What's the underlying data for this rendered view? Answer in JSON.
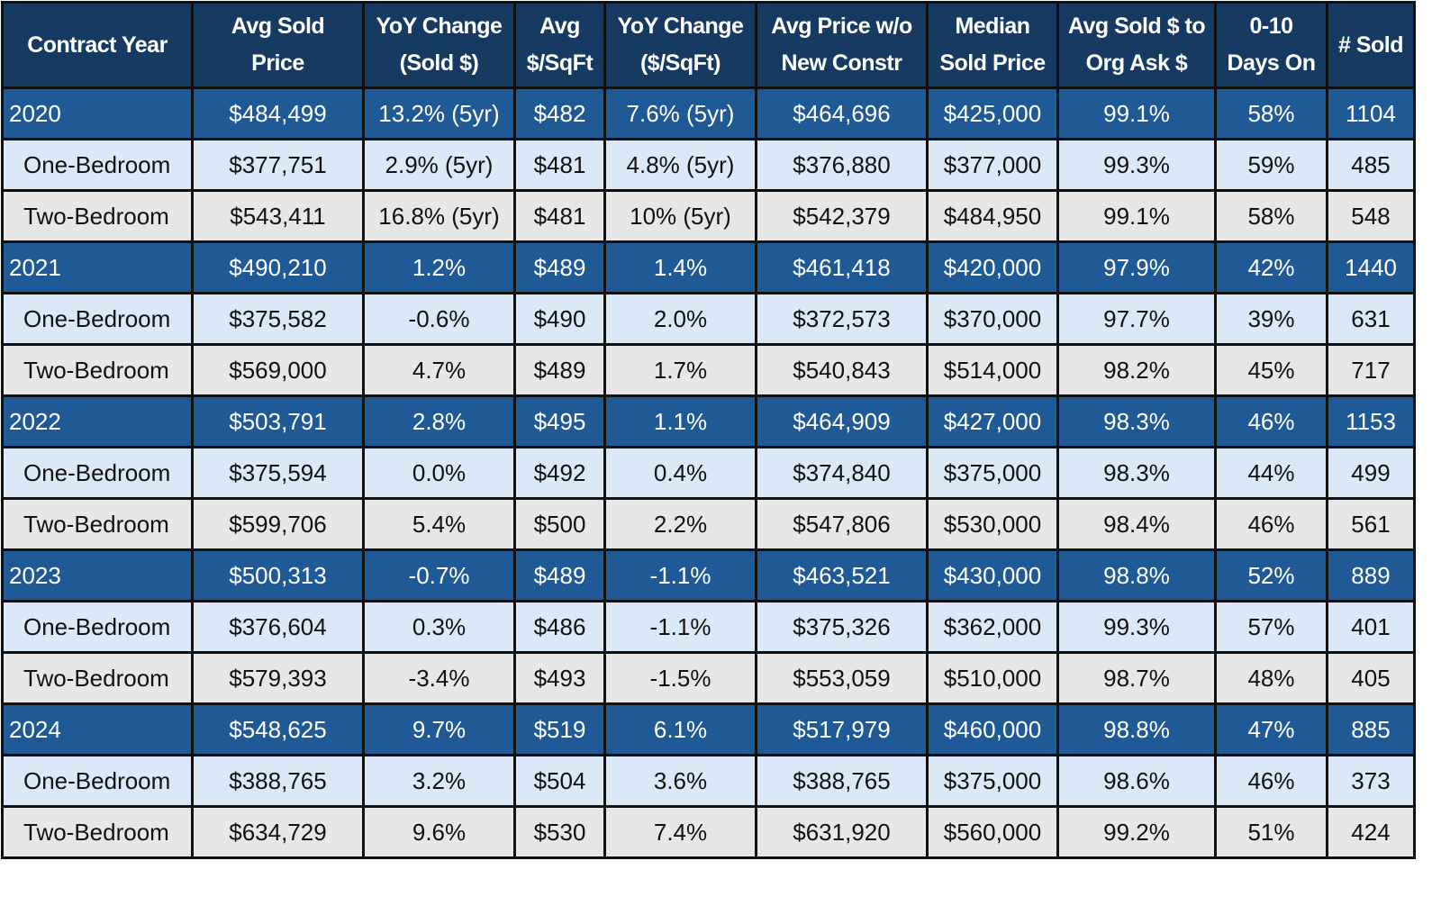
{
  "table": {
    "headers": [
      "Contract Year",
      "Avg Sold Price",
      "YoY Change (Sold $)",
      "Avg $/SqFt",
      "YoY Change ($/SqFt)",
      "Avg Price w/o New Constr",
      "Median Sold Price",
      "Avg Sold $ to Org Ask $",
      "0-10 Days On",
      "# Sold"
    ],
    "header_lines": [
      [
        "Contract Year"
      ],
      [
        "Avg Sold",
        "Price"
      ],
      [
        "YoY Change",
        "(Sold $)"
      ],
      [
        "Avg",
        "$/SqFt"
      ],
      [
        "YoY Change",
        "($/SqFt)"
      ],
      [
        "Avg Price w/o",
        "New Constr"
      ],
      [
        "Median",
        "Sold Price"
      ],
      [
        "Avg Sold $ to",
        "Org Ask $"
      ],
      [
        "0-10",
        "Days On"
      ],
      [
        "# Sold"
      ]
    ],
    "rows": [
      {
        "type": "year",
        "cells": [
          "2020",
          "$484,499",
          "13.2% (5yr)",
          "$482",
          "7.6% (5yr)",
          "$464,696",
          "$425,000",
          "99.1%",
          "58%",
          "1104"
        ]
      },
      {
        "type": "one",
        "cells": [
          "One-Bedroom",
          "$377,751",
          "2.9% (5yr)",
          "$481",
          "4.8% (5yr)",
          "$376,880",
          "$377,000",
          "99.3%",
          "59%",
          "485"
        ]
      },
      {
        "type": "two",
        "cells": [
          "Two-Bedroom",
          "$543,411",
          "16.8% (5yr)",
          "$481",
          "10% (5yr)",
          "$542,379",
          "$484,950",
          "99.1%",
          "58%",
          "548"
        ]
      },
      {
        "type": "year",
        "cells": [
          "2021",
          "$490,210",
          "1.2%",
          "$489",
          "1.4%",
          "$461,418",
          "$420,000",
          "97.9%",
          "42%",
          "1440"
        ]
      },
      {
        "type": "one",
        "cells": [
          "One-Bedroom",
          "$375,582",
          "-0.6%",
          "$490",
          "2.0%",
          "$372,573",
          "$370,000",
          "97.7%",
          "39%",
          "631"
        ]
      },
      {
        "type": "two",
        "cells": [
          "Two-Bedroom",
          "$569,000",
          "4.7%",
          "$489",
          "1.7%",
          "$540,843",
          "$514,000",
          "98.2%",
          "45%",
          "717"
        ]
      },
      {
        "type": "year",
        "cells": [
          "2022",
          "$503,791",
          "2.8%",
          "$495",
          "1.1%",
          "$464,909",
          "$427,000",
          "98.3%",
          "46%",
          "1153"
        ]
      },
      {
        "type": "one",
        "cells": [
          "One-Bedroom",
          "$375,594",
          "0.0%",
          "$492",
          "0.4%",
          "$374,840",
          "$375,000",
          "98.3%",
          "44%",
          "499"
        ]
      },
      {
        "type": "two",
        "cells": [
          "Two-Bedroom",
          "$599,706",
          "5.4%",
          "$500",
          "2.2%",
          "$547,806",
          "$530,000",
          "98.4%",
          "46%",
          "561"
        ]
      },
      {
        "type": "year",
        "cells": [
          "2023",
          "$500,313",
          "-0.7%",
          "$489",
          "-1.1%",
          "$463,521",
          "$430,000",
          "98.8%",
          "52%",
          "889"
        ]
      },
      {
        "type": "one",
        "cells": [
          "One-Bedroom",
          "$376,604",
          "0.3%",
          "$486",
          "-1.1%",
          "$375,326",
          "$362,000",
          "99.3%",
          "57%",
          "401"
        ]
      },
      {
        "type": "two",
        "cells": [
          "Two-Bedroom",
          "$579,393",
          "-3.4%",
          "$493",
          "-1.5%",
          "$553,059",
          "$510,000",
          "98.7%",
          "48%",
          "405"
        ]
      },
      {
        "type": "year",
        "cells": [
          "2024",
          "$548,625",
          "9.7%",
          "$519",
          "6.1%",
          "$517,979",
          "$460,000",
          "98.8%",
          "47%",
          "885"
        ]
      },
      {
        "type": "one",
        "cells": [
          "One-Bedroom",
          "$388,765",
          "3.2%",
          "$504",
          "3.6%",
          "$388,765",
          "$375,000",
          "98.6%",
          "46%",
          "373"
        ]
      },
      {
        "type": "two",
        "cells": [
          "Two-Bedroom",
          "$634,729",
          "9.6%",
          "$530",
          "7.4%",
          "$631,920",
          "$560,000",
          "99.2%",
          "51%",
          "424"
        ]
      }
    ]
  },
  "colors": {
    "header_bg": "#173a62",
    "year_row_bg": "#1f5a96",
    "one_bedroom_row_bg": "#dae8f7",
    "two_bedroom_row_bg": "#e7e7e7",
    "border": "#111111"
  }
}
